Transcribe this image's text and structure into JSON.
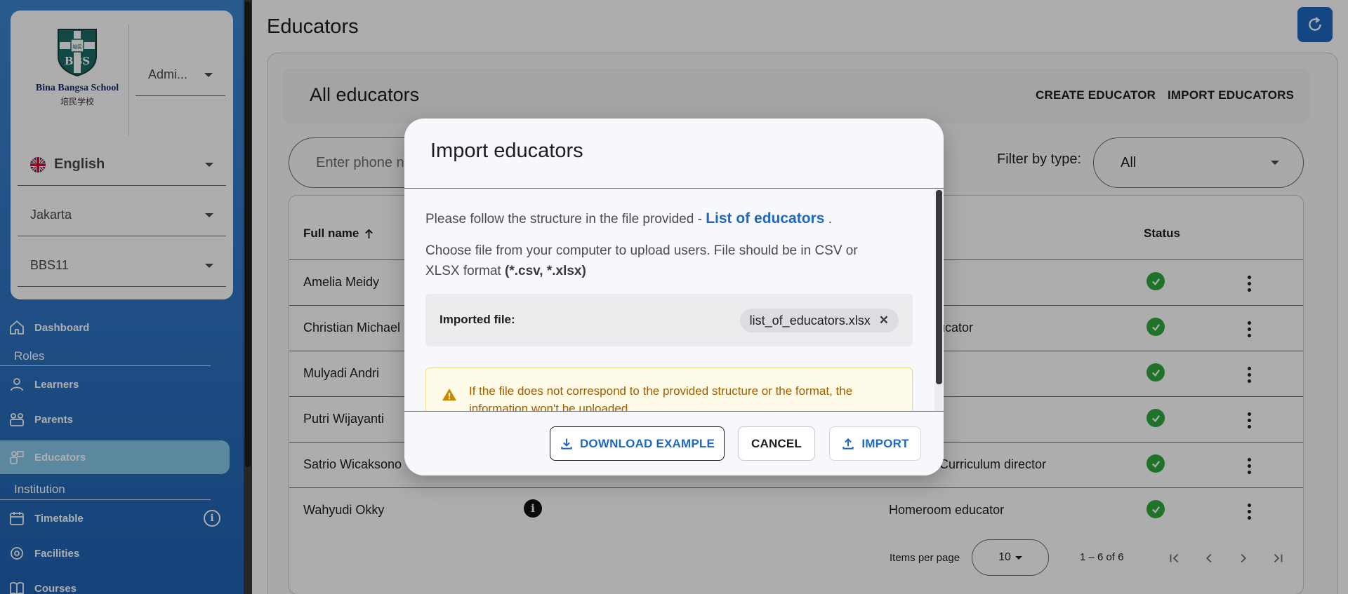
{
  "sidebar": {
    "logo": {
      "name": "Bina Bangsa School",
      "sub": "培民学校",
      "crest": "BBS",
      "crest_top": "培民"
    },
    "role": "Admi...",
    "language": "English",
    "city": "Jakarta",
    "class": "BBS11",
    "nav": {
      "dashboard": "Dashboard",
      "roles_section": "Roles",
      "learners": "Learners",
      "parents": "Parents",
      "educators": "Educators",
      "institution_section": "Institution",
      "timetable": "Timetable",
      "facilities": "Facilities",
      "courses": "Courses"
    }
  },
  "main": {
    "page_title": "Educators",
    "header_title": "All educators",
    "create_button": "CREATE EDUCATOR",
    "import_button": "IMPORT EDUCATORS",
    "search_placeholder": "Enter phone n",
    "filter_label": "Filter by type:",
    "filter_value": "All",
    "table": {
      "col_name": "Full name",
      "col_status": "Status",
      "rows": [
        {
          "name": "Amelia Meidy",
          "role": ""
        },
        {
          "name": "Christian Michael",
          "role": "m educator"
        },
        {
          "name": "Mulyadi Andri",
          "role": ""
        },
        {
          "name": "Putri Wijayanti",
          "role": ""
        },
        {
          "name": "Satrio Wicaksono",
          "role": "Curriculum director"
        },
        {
          "name": "Wahyudi Okky",
          "role": "Homeroom educator"
        }
      ]
    },
    "pager": {
      "items_per_page_label": "Items per page",
      "items_per_page": "10",
      "range": "1 – 6 of 6"
    }
  },
  "dialog": {
    "title": "Import educators",
    "structure_text": "Please follow the structure in the file provided - ",
    "structure_link": "List of educators",
    "structure_end": " .",
    "choose_text_1": "Choose file from your computer to upload users. File should be in CSV or",
    "choose_text_2": "XLSX format",
    "choose_text_formats": "(*.csv, *.xlsx)",
    "imported_label": "Imported file:",
    "file_name": "list_of_educators.xlsx",
    "warning": "If the file does not correspond to the provided structure or the format, the information won't be uploaded",
    "download_button": "DOWNLOAD EXAMPLE",
    "cancel_button": "CANCEL",
    "import_button": "IMPORT"
  },
  "colors": {
    "primary": "#1d68c1",
    "status_ok": "#2eaa3c",
    "warning_text": "#a05c00"
  },
  "icons": {
    "sidebar": [
      "home-icon",
      "person-icon",
      "family-icon",
      "educator-icon",
      "calendar-icon",
      "facility-icon",
      "book-icon"
    ],
    "misc": [
      "refresh-icon",
      "arrow-up-icon",
      "check-circle-icon",
      "kebab-icon",
      "info-icon",
      "download-icon",
      "upload-icon",
      "warning-icon",
      "close-icon"
    ]
  }
}
